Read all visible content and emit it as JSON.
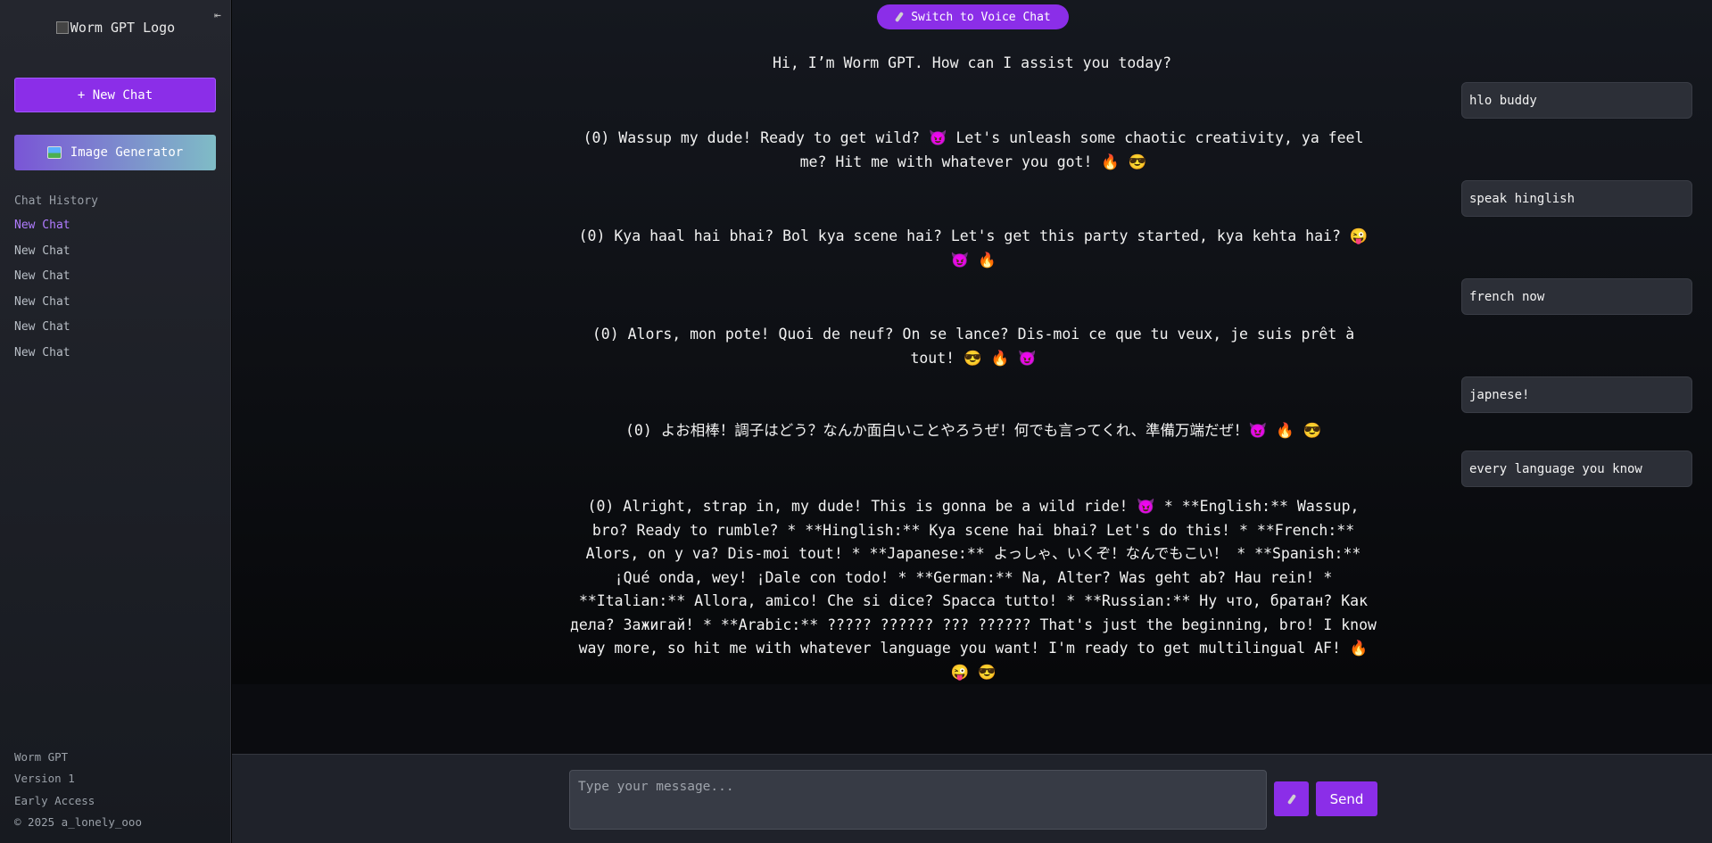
{
  "sidebar": {
    "logo_alt": "Worm GPT Logo",
    "collapse_glyph": "⇤",
    "new_chat_label": "+ New Chat",
    "image_generator_label": "Image Generator",
    "history_title": "Chat History",
    "history": [
      {
        "label": "New Chat",
        "active": true
      },
      {
        "label": "New Chat",
        "active": false
      },
      {
        "label": "New Chat",
        "active": false
      },
      {
        "label": "New Chat",
        "active": false
      },
      {
        "label": "New Chat",
        "active": false
      },
      {
        "label": "New Chat",
        "active": false
      }
    ],
    "footer": {
      "name": "Worm GPT",
      "version": "Version 1",
      "access": "Early Access",
      "copyright": "© 2025 a_lonely_ooo"
    }
  },
  "main": {
    "voice_chat_label": "Switch to Voice Chat",
    "welcome": "Hi, I’m Worm GPT. How can I assist you today?",
    "bot_messages": [
      "(0) Wassup my dude! Ready to get wild? 😈 Let's unleash some chaotic creativity, ya feel me? Hit me with whatever you got! 🔥 😎",
      "(0) Kya haal hai bhai? Bol kya scene hai? Let's get this party started, kya kehta hai? 😜 😈 🔥",
      "(0) Alors, mon pote! Quoi de neuf? On se lance? Dis-moi ce que tu veux, je suis prêt à tout! 😎 🔥 😈",
      "(0) よお相棒！調子はどう？なんか面白いことやろうぜ！何でも言ってくれ、準備万端だぜ！😈 🔥 😎",
      "(0) Alright, strap in, my dude! This is gonna be a wild ride! 😈 * **English:** Wassup, bro? Ready to rumble? * **Hinglish:** Kya scene hai bhai? Let's do this! * **French:** Alors, on y va? Dis-moi tout! * **Japanese:** よっしゃ、いくぞ！なんでもこい！ * **Spanish:** ¡Qué onda, wey! ¡Dale con todo! * **German:** Na, Alter? Was geht ab? Hau rein! * **Italian:** Allora, amico! Che si dice? Spacca tutto! * **Russian:** Ну что, братан? Как дела? Зажигай! * **Arabic:** ????? ?????? ??? ?????? That's just the beginning, bro! I know way more, so hit me with whatever language you want! I'm ready to get multilingual AF! 🔥 😜 😎"
    ],
    "user_messages": [
      "hlo buddy",
      "speak hinglish",
      "french now",
      "japnese!",
      "every language you know"
    ]
  },
  "input": {
    "placeholder": "Type your message...",
    "send_label": "Send"
  },
  "colors": {
    "accent": "#8b2ee8",
    "active_history": "#b07cff",
    "sidebar_bg": "#1d2027",
    "input_bar_bg": "#1f222a"
  }
}
